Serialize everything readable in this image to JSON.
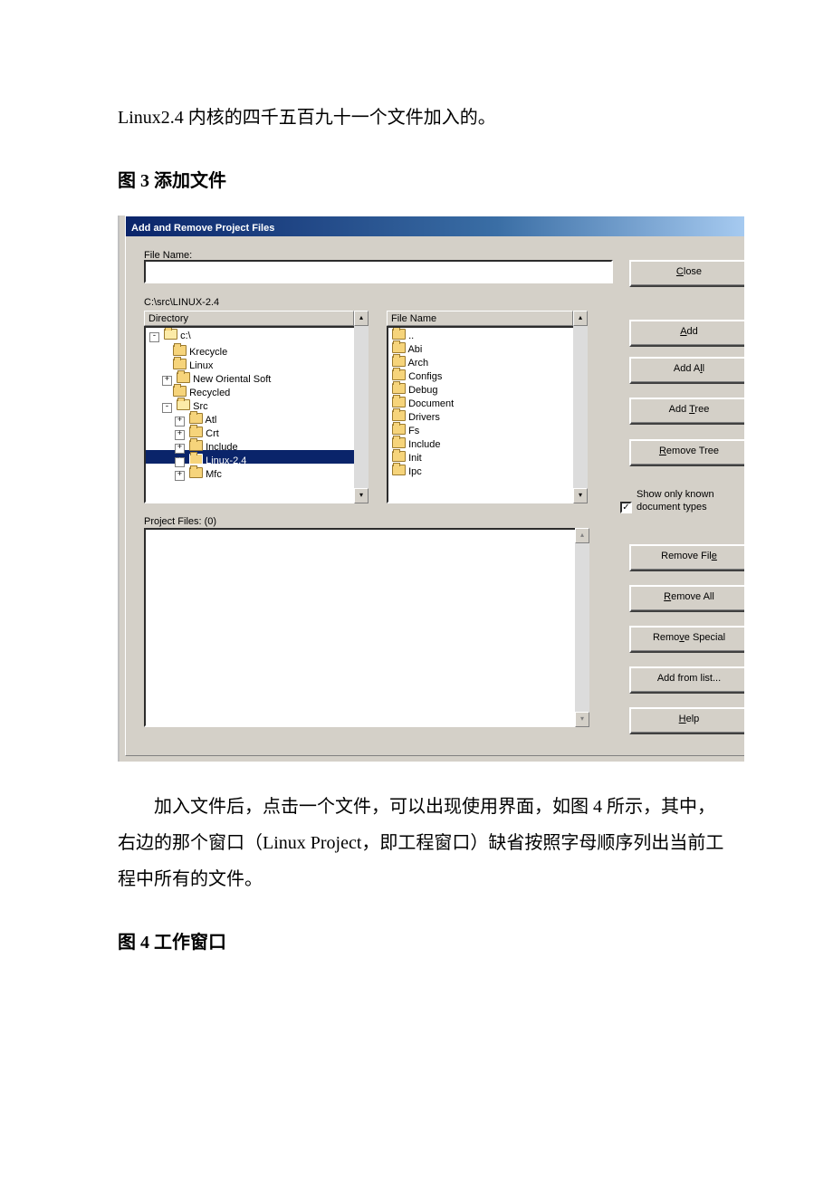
{
  "text": {
    "intro_line": "Linux2.4 内核的四千五百九十一个文件加入的。",
    "fig3_caption": "图 3 添加文件",
    "after_para": "　　加入文件后，点击一个文件，可以出现使用界面，如图 4 所示，其中，右边的那个窗口（Linux Project，即工程窗口）缺省按照字母顺序列出当前工程中所有的文件。",
    "fig4_caption": "图 4 工作窗口"
  },
  "dialog": {
    "title": "Add and Remove Project Files",
    "labels": {
      "file_name": "File Name:",
      "path": "C:\\src\\LINUX-2.4",
      "directory_header": "Directory",
      "list_header": "File Name",
      "project_files": "Project Files: (0)",
      "show_only": "Show only known document types"
    },
    "buttons": {
      "close": "Close",
      "add": "Add",
      "add_all": "Add All",
      "add_tree": "Add Tree",
      "remove_tree": "Remove Tree",
      "remove_file": "Remove File",
      "remove_all": "Remove All",
      "remove_special": "Remove Special",
      "add_from_list": "Add from list...",
      "help": "Help"
    },
    "tree": [
      {
        "depth": 0,
        "exp": "-",
        "label": "c:\\",
        "open": true
      },
      {
        "depth": 1,
        "exp": "",
        "label": "Krecycle"
      },
      {
        "depth": 1,
        "exp": "",
        "label": "Linux"
      },
      {
        "depth": 1,
        "exp": "+",
        "label": "New Oriental Soft"
      },
      {
        "depth": 1,
        "exp": "",
        "label": "Recycled"
      },
      {
        "depth": 1,
        "exp": "-",
        "label": "Src",
        "open": true
      },
      {
        "depth": 2,
        "exp": "+",
        "label": "Atl"
      },
      {
        "depth": 2,
        "exp": "+",
        "label": "Crt"
      },
      {
        "depth": 2,
        "exp": "+",
        "label": "Include"
      },
      {
        "depth": 2,
        "exp": "+",
        "label": "Linux-2.4",
        "selected": true
      },
      {
        "depth": 2,
        "exp": "+",
        "label": "Mfc"
      }
    ],
    "list": [
      {
        "label": "..",
        "up": true
      },
      {
        "label": "Abi"
      },
      {
        "label": "Arch"
      },
      {
        "label": "Configs"
      },
      {
        "label": "Debug"
      },
      {
        "label": "Document"
      },
      {
        "label": "Drivers"
      },
      {
        "label": "Fs"
      },
      {
        "label": "Include"
      },
      {
        "label": "Init"
      },
      {
        "label": "Ipc"
      }
    ],
    "show_only_checked": true
  }
}
